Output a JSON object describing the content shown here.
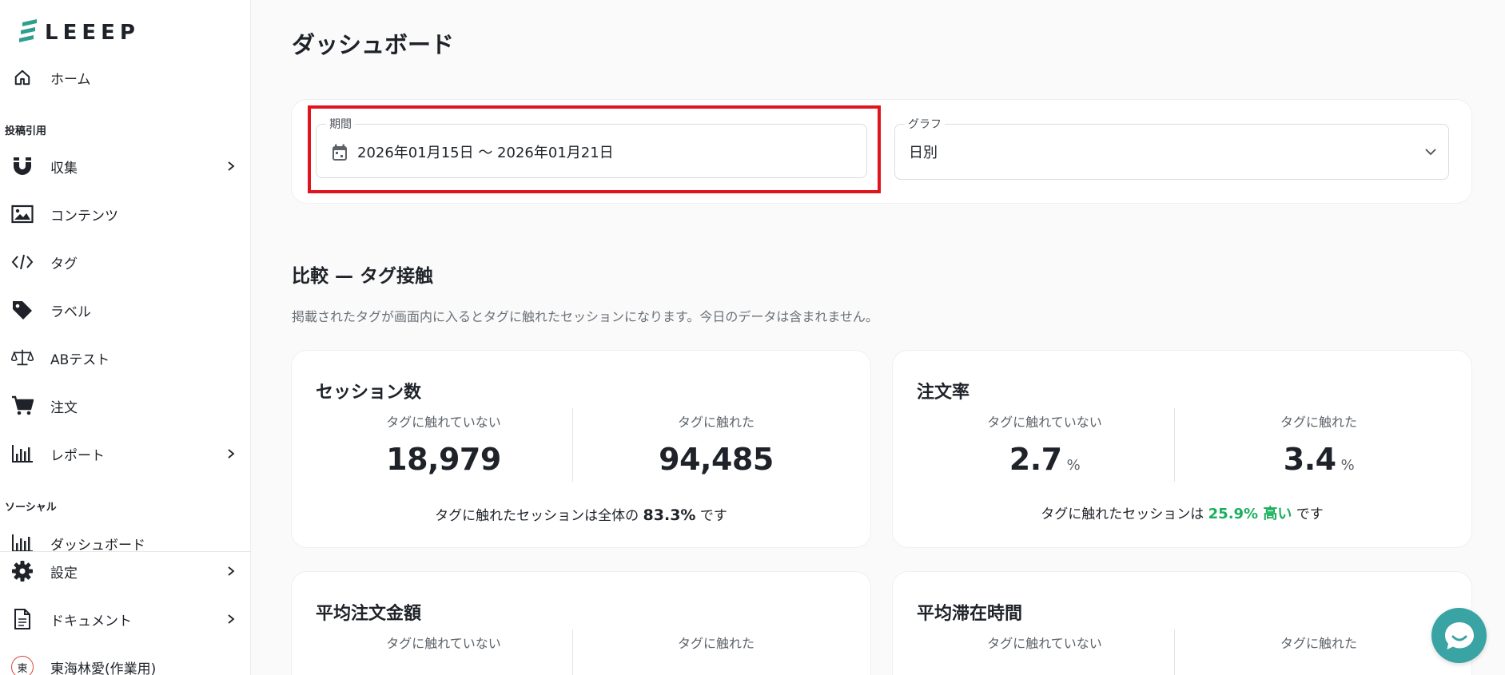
{
  "app": {
    "logo_text": "LEEEP",
    "brand_color": "#2f9e8f"
  },
  "sidebar": {
    "home": "ホーム",
    "section_posts": "投稿引用",
    "collect": "収集",
    "contents": "コンテンツ",
    "tags": "タグ",
    "labels": "ラベル",
    "abtest": "ABテスト",
    "orders": "注文",
    "reports": "レポート",
    "section_social": "ソーシャル",
    "dashboard": "ダッシュボード",
    "settings": "設定",
    "documents": "ドキュメント",
    "user_initial": "東",
    "user_name": "東海林愛(作業用)"
  },
  "main": {
    "title": "ダッシュボード",
    "period": {
      "label": "期間",
      "value": "2026年01月15日 〜 2026年01月21日"
    },
    "graph": {
      "label": "グラフ",
      "value": "日別"
    },
    "compare_title": "比較 — タグ接触",
    "compare_desc": "掲載されたタグが画面内に入るとタグに触れたセッションになります。今日のデータは含まれません。",
    "cards": {
      "sessions": {
        "title": "セッション数",
        "col_a": "タグに触れていない",
        "col_b": "タグに触れた",
        "val_a": "18,979",
        "val_b": "94,485",
        "summary_pre": "タグに触れたセッションは全体の",
        "summary_value": "83.3%",
        "summary_post": "です"
      },
      "order_rate": {
        "title": "注文率",
        "col_a": "タグに触れていない",
        "col_b": "タグに触れた",
        "val_a": "2.7",
        "val_b": "3.4",
        "unit": "%",
        "summary_pre": "タグに触れたセッションは",
        "summary_value": "25.9% 高い",
        "summary_post": "です",
        "highlight_color": "#1aaf5d"
      },
      "avg_order": {
        "title": "平均注文金額",
        "col_a": "タグに触れていない",
        "col_b": "タグに触れた"
      },
      "avg_stay": {
        "title": "平均滞在時間",
        "col_a": "タグに触れていない",
        "col_b": "タグに触れた"
      }
    }
  }
}
